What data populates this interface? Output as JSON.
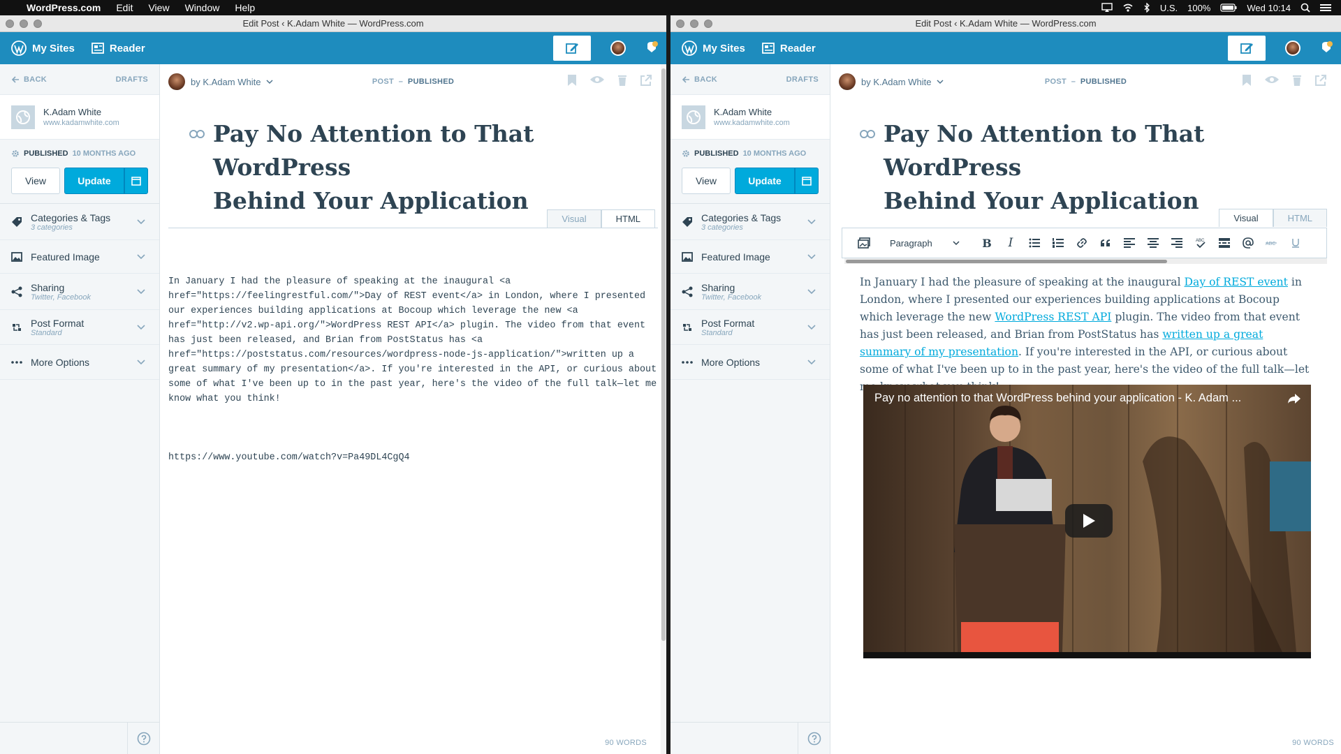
{
  "menubar": {
    "app_name": "WordPress.com",
    "items": [
      "Edit",
      "View",
      "Window",
      "Help"
    ],
    "locale": "U.S.",
    "battery": "100%",
    "clock": "Wed 10:14"
  },
  "window_title": "Edit Post ‹ K.Adam White — WordPress.com",
  "masterbar": {
    "my_sites": "My Sites",
    "reader": "Reader"
  },
  "sidebar": {
    "back": "BACK",
    "drafts": "DRAFTS",
    "site_name": "K.Adam White",
    "site_url": "www.kadamwhite.com",
    "status": "PUBLISHED",
    "status_ago": "10 MONTHS AGO",
    "view_label": "View",
    "update_label": "Update",
    "sections": [
      {
        "label": "Categories & Tags",
        "sub": "3 categories",
        "icon": "tag-icon"
      },
      {
        "label": "Featured Image",
        "sub": "",
        "icon": "image-icon"
      },
      {
        "label": "Sharing",
        "sub": "Twitter, Facebook",
        "icon": "share-icon"
      },
      {
        "label": "Post Format",
        "sub": "Standard",
        "icon": "post-format-icon"
      },
      {
        "label": "More Options",
        "sub": "",
        "icon": "ellipsis-icon"
      }
    ]
  },
  "editor": {
    "byline": "by K.Adam White",
    "post_type": "POST",
    "post_status": "PUBLISHED",
    "title_line1": "Pay No Attention to That WordPress",
    "title_line2": "Behind Your Application",
    "tab_visual": "Visual",
    "tab_html": "HTML",
    "word_count": "90 WORDS",
    "format_select": "Paragraph"
  },
  "html_content": {
    "p1": "In January I had the pleasure of speaking at the inaugural <a href=\"https://feelingrestful.com/\">Day of REST event</a> in London, where I presented our experiences building applications at Bocoup which leverage the new <a href=\"http://v2.wp-api.org/\">WordPress REST API</a> plugin. The video from that event has just been released, and Brian from PostStatus has <a href=\"https://poststatus.com/resources/wordpress-node-js-application/\">written up a great summary of my presentation</a>. If you're interested in the API, or curious about some of what I've been up to in the past year, here's the video of the full talk—let me know what you think!",
    "p2": "https://www.youtube.com/watch?v=Pa49DL4CgQ4"
  },
  "visual_content": {
    "t1": "In January I had the pleasure of speaking at the inaugural ",
    "link1": "Day of REST event",
    "t2": " in London, where I presented our experiences building applications at Bocoup which leverage the new ",
    "link2": "WordPress REST API",
    "t3": " plugin. The video from that event has just been released, and Brian from PostStatus has ",
    "link3": "written up a great summary of my presentation",
    "t4": ". If you're interested in the API, or curious about some of what I've been up to in the past year, here's the video of the full talk—let me know what you think!"
  },
  "video": {
    "title": "Pay no attention to that WordPress behind your application - K. Adam ..."
  },
  "colors": {
    "masterbar": "#1e8cbe",
    "accent": "#00aadc",
    "text": "#2e4453"
  }
}
